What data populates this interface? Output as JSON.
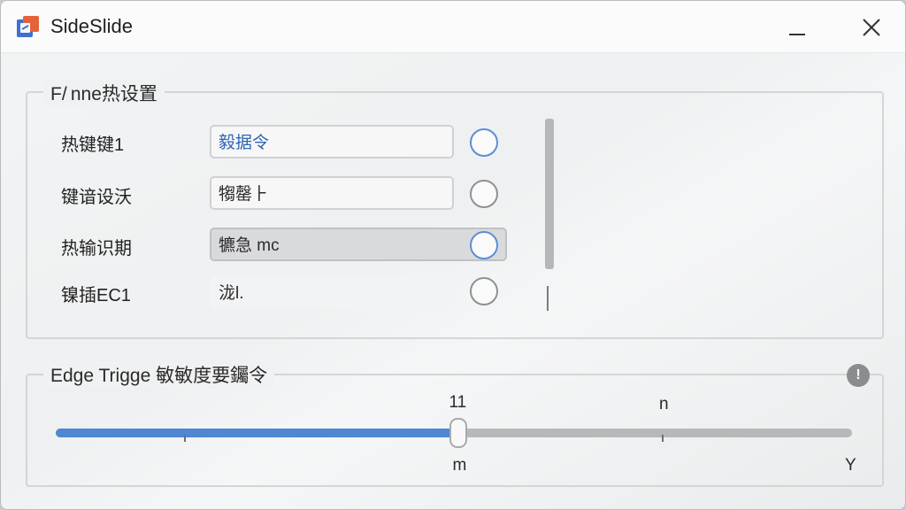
{
  "window": {
    "title": "SideSlide",
    "icon": "app-logo-icon",
    "controls": {
      "minimize": "minimize-icon",
      "close": "close-icon"
    }
  },
  "hotkey_group": {
    "legend": "F/ nne热设置",
    "rows": [
      {
        "label": "热键键1",
        "value": "毅据令",
        "radio": "circle-icon"
      },
      {
        "label": "键谙设沃",
        "value": "犓罄⺊",
        "radio": "circle-icon"
      },
      {
        "label": "热输识期",
        "value": "犥急 mc",
        "radio": "circle-icon"
      },
      {
        "label": "镍插EC1",
        "value": "泷l.",
        "radio": "circle-icon"
      }
    ]
  },
  "edge_group": {
    "legend": "Edge Trigge 敏敏度要钃令",
    "info_icon": "info-icon",
    "slider": {
      "value_fraction": 0.505,
      "label_above_thumb": "11",
      "label_above_right": "n",
      "label_below_thumb": "m",
      "label_below_end": "Y"
    }
  },
  "colors": {
    "accent": "#4f87d2",
    "radio_active": "#5a8fd6",
    "text_blue": "#2f63b5"
  }
}
